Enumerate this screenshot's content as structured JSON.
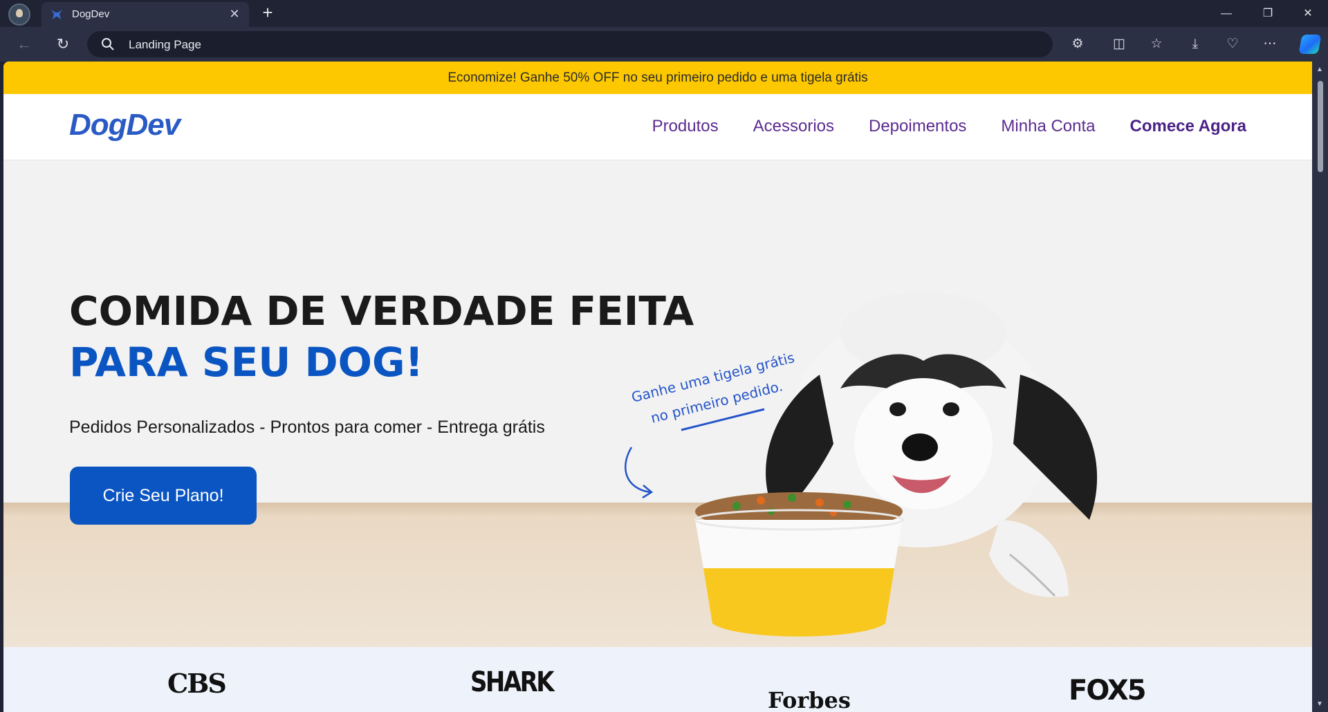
{
  "browser": {
    "tab_title": "DogDev",
    "address": "Landing Page"
  },
  "colors": {
    "promo_bg": "#fdc800",
    "brand_blue": "#0b55c2",
    "nav_purple": "#5b2b8f",
    "chrome_bg": "#1f2333"
  },
  "page": {
    "promo_text": "Economize! Ganhe 50% OFF no seu primeiro pedido e uma tigela grátis",
    "logo": "DogDev",
    "nav": [
      {
        "label": "Produtos"
      },
      {
        "label": "Acessorios"
      },
      {
        "label": "Depoimentos"
      },
      {
        "label": "Minha Conta"
      },
      {
        "label": "Comece Agora"
      }
    ],
    "hero": {
      "title_line1": "COMIDA DE VERDADE FEITA",
      "title_line2": "PARA SEU DOG!",
      "subtitle": "Pedidos Personalizados - Prontos para comer - Entrega grátis",
      "button": "Crie Seu Plano!",
      "callout_line1": "Ganhe uma tigela grátis",
      "callout_line2": "no primeiro pedido."
    },
    "press": [
      "CBS",
      "SHARK",
      "Forbes",
      "FOX5"
    ]
  }
}
